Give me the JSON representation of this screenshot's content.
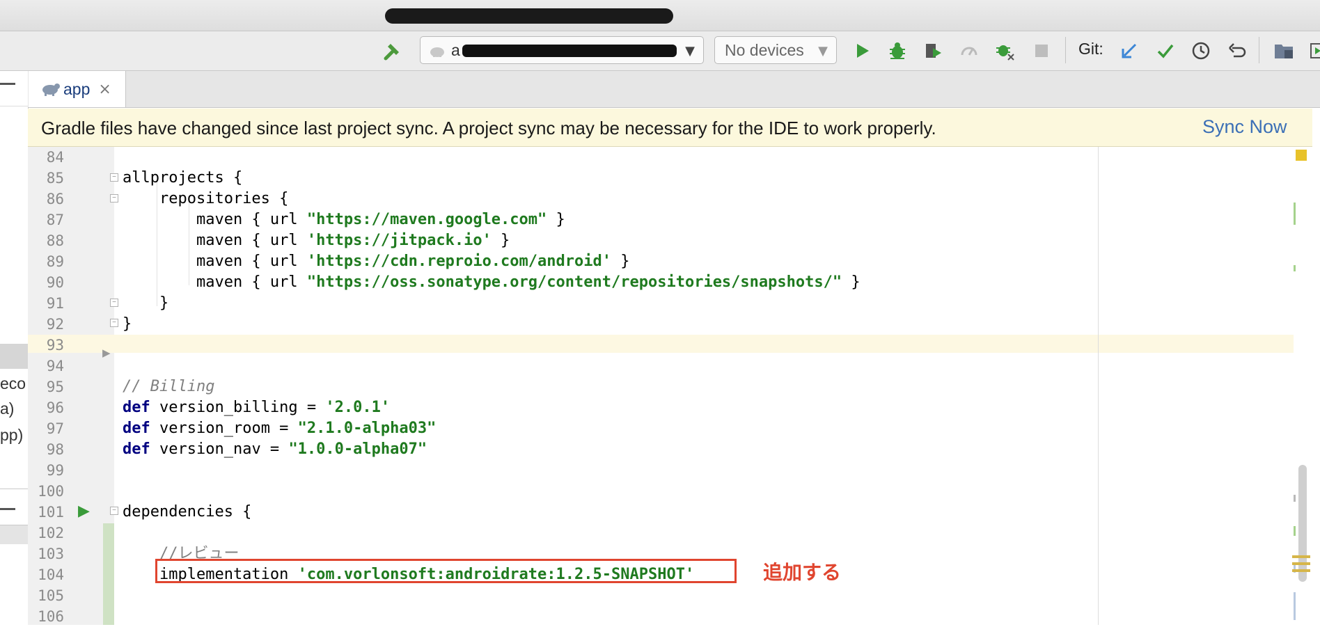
{
  "toolbar": {
    "run_config_value": "a",
    "devices_value": "No devices",
    "git_label": "Git:"
  },
  "icons": [
    "hammer-icon",
    "android-icon",
    "run-icon",
    "debug-icon",
    "profile-icon",
    "apply-changes-icon",
    "attach-debugger-icon",
    "stop-icon",
    "git-update-icon",
    "git-commit-icon",
    "git-history-icon",
    "git-rollback-icon",
    "project-structure-icon",
    "preview-icon",
    "close-icon",
    "fold-icon"
  ],
  "tab": {
    "label": "app",
    "close": "×"
  },
  "banner": {
    "message": "Gradle files have changed since last project sync. A project sync may be necessary for the IDE to work properly.",
    "action": "Sync Now"
  },
  "left_panel": {
    "text1": "eco",
    "text2": "a)",
    "text3": "pp)"
  },
  "editor": {
    "line_numbers": [
      "84",
      "85",
      "86",
      "87",
      "88",
      "89",
      "90",
      "91",
      "92",
      "93",
      "94",
      "95",
      "96",
      "97",
      "98",
      "99",
      "100",
      "101",
      "102",
      "103",
      "104",
      "105",
      "106"
    ],
    "lines": {
      "l85": "allprojects {",
      "l86": "    repositories {",
      "l87_a": "        maven { url ",
      "l87_s": "\"https://maven.google.com\"",
      "l87_b": " }",
      "l88_a": "        maven { url ",
      "l88_s": "'https://jitpack.io'",
      "l88_b": " }",
      "l89_a": "        maven { url ",
      "l89_s": "'https://cdn.reproio.com/android'",
      "l89_b": " }",
      "l90_a": "        maven { url ",
      "l90_s": "\"https://oss.sonatype.org/content/repositories/snapshots/\"",
      "l90_b": " }",
      "l91": "    }",
      "l92": "}",
      "l95": "// Billing",
      "l96_kw": "def",
      "l96_a": " version_billing = ",
      "l96_s": "'2.0.1'",
      "l97_kw": "def",
      "l97_a": " version_room = ",
      "l97_s": "\"2.1.0-alpha03\"",
      "l98_kw": "def",
      "l98_a": " version_nav = ",
      "l98_s": "\"1.0.0-alpha07\"",
      "l101": "dependencies {",
      "l103": "    //レビュー",
      "l104_a": "    implementation ",
      "l104_s": "'com.vorlonsoft:androidrate:1.2.5-SNAPSHOT'"
    },
    "annotation": "追加する"
  },
  "colors": {
    "banner_bg": "#fcf8dd",
    "link": "#3b6fb6",
    "keyword": "#000080",
    "string": "#1f7a1f",
    "comment": "#808080",
    "annotation": "#e0452f",
    "run_green": "#3a9b3a"
  }
}
